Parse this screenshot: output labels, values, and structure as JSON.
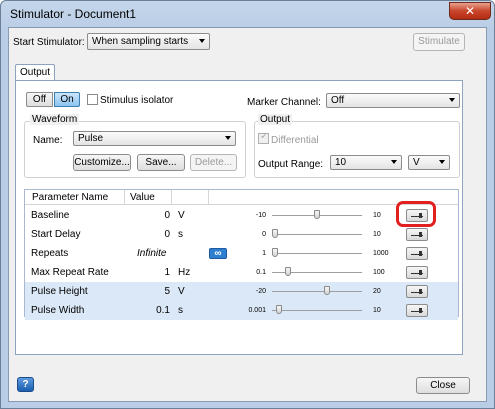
{
  "window": {
    "title": "Stimulator - Document1",
    "close_glyph": "✕"
  },
  "top": {
    "start_label": "Start Stimulator:",
    "start_value": "When sampling starts",
    "stimulate_button": "Stimulate"
  },
  "tab": {
    "label": "Output"
  },
  "toggle": {
    "off": "Off",
    "on": "On"
  },
  "stimulus_isolator": "Stimulus isolator",
  "marker": {
    "label": "Marker Channel:",
    "value": "Off"
  },
  "waveform": {
    "group_label": "Waveform",
    "name_label": "Name:",
    "name_value": "Pulse",
    "customize": "Customize...",
    "save": "Save...",
    "delete": "Delete..."
  },
  "output": {
    "group_label": "Output",
    "differential": "Differential",
    "range_label": "Output Range:",
    "range_value": "10",
    "unit_value": "V"
  },
  "table": {
    "headers": {
      "name": "Parameter Name",
      "value": "Value"
    },
    "rows": [
      {
        "name": "Baseline",
        "value": "0",
        "unit": "V",
        "min": "-10",
        "max": "10",
        "fraction": 0.5
      },
      {
        "name": "Start Delay",
        "value": "0",
        "unit": "s",
        "min": "0",
        "max": "10",
        "fraction": 0.0
      },
      {
        "name": "Repeats",
        "value": "Infinite",
        "unit": "",
        "loop_glyph": "∞",
        "min": "1",
        "max": "1000",
        "fraction": 0.0
      },
      {
        "name": "Max Repeat Rate",
        "value": "1",
        "unit": "Hz",
        "min": "0.1",
        "max": "100",
        "fraction": 0.15
      },
      {
        "name": "Pulse Height",
        "value": "5",
        "unit": "V",
        "min": "-20",
        "max": "20",
        "fraction": 0.62
      },
      {
        "name": "Pulse Width",
        "value": "0.1",
        "unit": "s",
        "min": "0.001",
        "max": "10",
        "fraction": 0.05
      }
    ]
  },
  "footer": {
    "help_glyph": "?",
    "close_button": "Close"
  }
}
